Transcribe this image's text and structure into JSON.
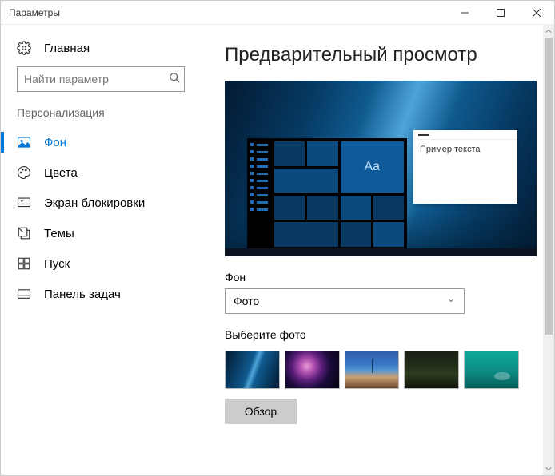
{
  "window": {
    "title": "Параметры"
  },
  "sidebar": {
    "home_label": "Главная",
    "search_placeholder": "Найти параметр",
    "section_label": "Персонализация",
    "items": [
      {
        "label": "Фон",
        "icon": "picture-icon",
        "active": true
      },
      {
        "label": "Цвета",
        "icon": "palette-icon",
        "active": false
      },
      {
        "label": "Экран блокировки",
        "icon": "lockscreen-icon",
        "active": false
      },
      {
        "label": "Темы",
        "icon": "themes-icon",
        "active": false
      },
      {
        "label": "Пуск",
        "icon": "start-icon",
        "active": false
      },
      {
        "label": "Панель задач",
        "icon": "taskbar-icon",
        "active": false
      }
    ]
  },
  "main": {
    "preview_heading": "Предварительный просмотр",
    "preview_sample_text": "Пример текста",
    "preview_tile_label": "Aa",
    "background_label": "Фон",
    "background_value": "Фото",
    "choose_photo_label": "Выберите фото",
    "browse_label": "Обзор",
    "thumbnails": [
      {
        "name": "windows-default"
      },
      {
        "name": "nebula"
      },
      {
        "name": "beach-reflection"
      },
      {
        "name": "dark-forest"
      },
      {
        "name": "teal-water"
      }
    ]
  },
  "colors": {
    "accent": "#0078d7"
  }
}
